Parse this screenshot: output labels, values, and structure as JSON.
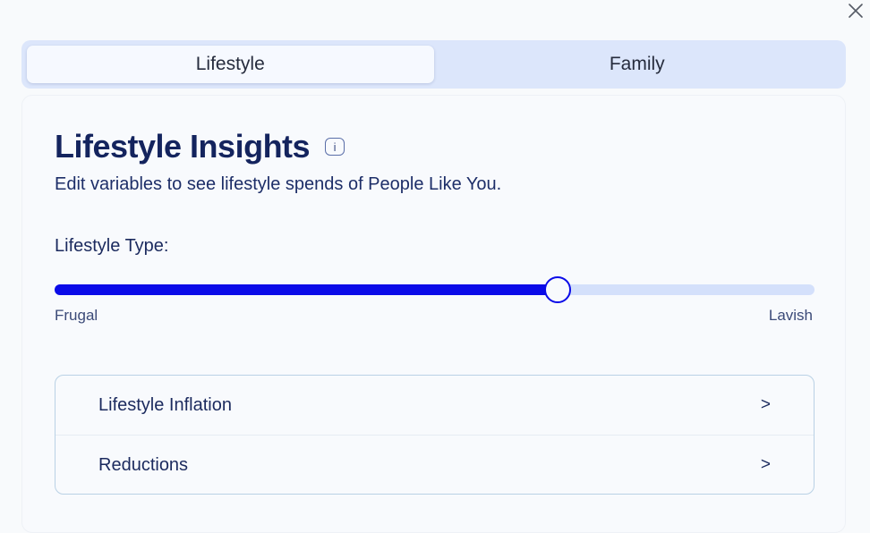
{
  "close_icon": "close-icon",
  "tabs": [
    {
      "label": "Lifestyle",
      "active": true
    },
    {
      "label": "Family",
      "active": false
    }
  ],
  "card": {
    "title": "Lifestyle Insights",
    "info_icon_text": "i",
    "subtitle": "Edit variables to see lifestyle spends of People Like You."
  },
  "lifestyle_type": {
    "label": "Lifestyle Type:",
    "min_label": "Frugal",
    "max_label": "Lavish",
    "value_fraction": 0.662
  },
  "accordion": {
    "items": [
      {
        "label": "Lifestyle Inflation",
        "chevron": ">"
      },
      {
        "label": "Reductions",
        "chevron": ">"
      }
    ]
  },
  "colors": {
    "accent": "#0b0be8",
    "track": "#d4e0fb",
    "text": "#1b2a5e"
  }
}
